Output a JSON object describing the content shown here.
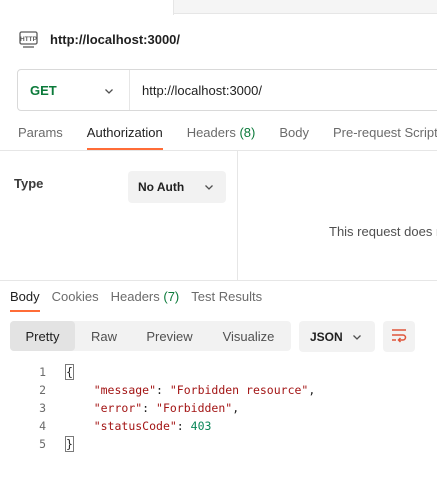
{
  "request": {
    "title": "http://localhost:3000/",
    "method": "GET",
    "url": "http://localhost:3000/"
  },
  "request_tabs": {
    "params": "Params",
    "authorization": "Authorization",
    "headers": "Headers",
    "headers_count": "(8)",
    "body": "Body",
    "prerequest": "Pre-request Script"
  },
  "auth": {
    "type_label": "Type",
    "type_value": "No Auth",
    "message": "This request does n"
  },
  "response_tabs": {
    "body": "Body",
    "cookies": "Cookies",
    "headers": "Headers",
    "headers_count": "(7)",
    "test_results": "Test Results"
  },
  "view_modes": {
    "pretty": "Pretty",
    "raw": "Raw",
    "preview": "Preview",
    "visualize": "Visualize"
  },
  "format": "JSON",
  "code": {
    "line_numbers": [
      "1",
      "2",
      "3",
      "4",
      "5"
    ],
    "open_brace": "{",
    "close_brace": "}",
    "k1": "\"message\"",
    "v1": "\"Forbidden resource\"",
    "k2": "\"error\"",
    "v2": "\"Forbidden\"",
    "k3": "\"statusCode\"",
    "v3": "403"
  },
  "colors": {
    "accent": "#ff6c37",
    "method_green": "#0b7a3a",
    "json_key": "#a31515",
    "json_number": "#098658"
  }
}
